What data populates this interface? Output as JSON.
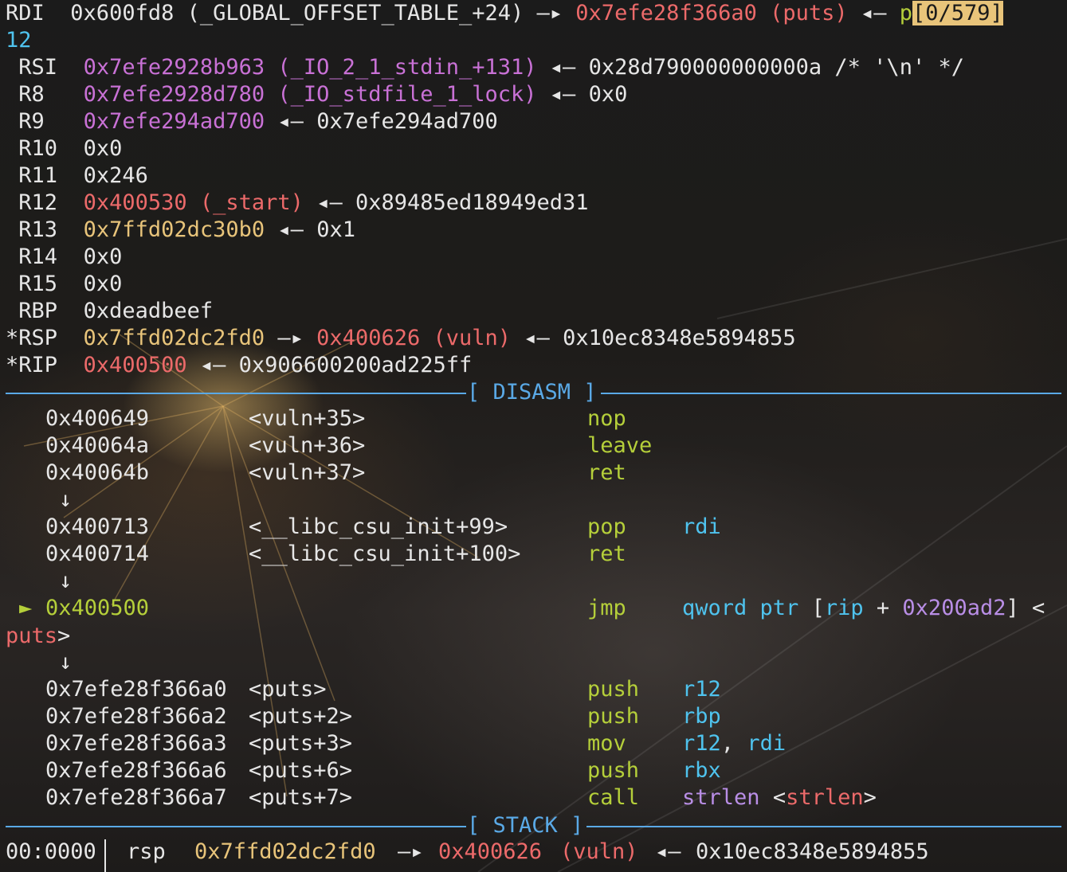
{
  "registers": [
    {
      "name": "RDI",
      "value": "0x600fd8",
      "sym": "(_GLOBAL_OFFSET_TABLE_+24)",
      "arrow": "—▸",
      "target": "0x7efe28f366a0",
      "target_sym": "(puts)",
      "arrow2": "◂—",
      "deref": "p",
      "pager": "[0/579]",
      "wrap": "12"
    },
    {
      "name": "RSI",
      "value": "0x7efe2928b963",
      "sym": "(_IO_2_1_stdin_+131)",
      "arrow": "◂—",
      "deref": "0x28d790000000000a /* '\\n' */"
    },
    {
      "name": "R8",
      "value": "0x7efe2928d780",
      "sym": "(_IO_stdfile_1_lock)",
      "arrow": "◂—",
      "deref": "0x0"
    },
    {
      "name": "R9",
      "value": "0x7efe294ad700",
      "arrow": "◂—",
      "deref": "0x7efe294ad700"
    },
    {
      "name": "R10",
      "value": "0x0"
    },
    {
      "name": "R11",
      "value": "0x246"
    },
    {
      "name": "R12",
      "value": "0x400530",
      "sym": "(_start)",
      "arrow": "◂—",
      "deref": "0x89485ed18949ed31"
    },
    {
      "name": "R13",
      "value": "0x7ffd02dc30b0",
      "arrow": "◂—",
      "deref": "0x1"
    },
    {
      "name": "R14",
      "value": "0x0"
    },
    {
      "name": "R15",
      "value": "0x0"
    },
    {
      "name": "RBP",
      "value": "0xdeadbeef"
    },
    {
      "name": "*RSP",
      "value": "0x7ffd02dc2fd0",
      "arrow": "—▸",
      "target": "0x400626",
      "target_sym": "(vuln)",
      "arrow2": "◂—",
      "deref": "0x10ec8348e5894855"
    },
    {
      "name": "*RIP",
      "value": "0x400500",
      "arrow": "◂—",
      "deref": "0x906600200ad225ff"
    }
  ],
  "disasm_title": "[ DISASM ]",
  "disasm": {
    "down_arrow": "↓",
    "current_marker": "►",
    "rows": [
      {
        "addr": "0x400649",
        "sym": "<vuln+35>",
        "op": "nop",
        "args": ""
      },
      {
        "addr": "0x40064a",
        "sym": "<vuln+36>",
        "op": "leave",
        "args": ""
      },
      {
        "addr": "0x40064b",
        "sym": "<vuln+37>",
        "op": "ret",
        "args": ""
      },
      {
        "addr": "0x400713",
        "sym": "<__libc_csu_init+99>",
        "op": "pop",
        "args": "rdi"
      },
      {
        "addr": "0x400714",
        "sym": "<__libc_csu_init+100>",
        "op": "ret",
        "args": ""
      },
      {
        "addr": "0x400500",
        "sym": "",
        "op": "jmp",
        "args_pre": "qword ptr",
        "args_bracket_open": "[",
        "args_reg": "rip",
        "args_plus": "+",
        "args_imm": "0x200ad2",
        "args_bracket_close": "]",
        "args_lt": "<",
        "wrap_sym": "puts",
        "wrap_gt": ">"
      },
      {
        "addr": "0x7efe28f366a0",
        "sym": "<puts>",
        "op": "push",
        "args": "r12"
      },
      {
        "addr": "0x7efe28f366a2",
        "sym": "<puts+2>",
        "op": "push",
        "args": "rbp"
      },
      {
        "addr": "0x7efe28f366a3",
        "sym": "<puts+3>",
        "op": "mov",
        "args": "r12",
        "args_comma": ",",
        "args2": "rdi"
      },
      {
        "addr": "0x7efe28f366a6",
        "sym": "<puts+6>",
        "op": "push",
        "args": "rbx"
      },
      {
        "addr": "0x7efe28f366a7",
        "sym": "<puts+7>",
        "op": "call",
        "args": "strlen",
        "args_lt": "<",
        "args_call_sym": "strlen",
        "args_gt": ">"
      }
    ]
  },
  "stack_title": "[ STACK ]",
  "stack": [
    {
      "offset": "00:0000",
      "label": "rsp",
      "addr": "0x7ffd02dc2fd0",
      "arrow": "—▸",
      "target": "0x400626",
      "target_sym": "(vuln)",
      "arrow2": "◂—",
      "deref": "0x10ec8348e5894855"
    }
  ],
  "colors": {
    "accent": "#5aa9e6",
    "code": "#ec6a6a",
    "heap_stack": "#e8c47a",
    "libc": "#c971d6",
    "op": "#b5cf3a",
    "reg": "#4fc3ee"
  }
}
